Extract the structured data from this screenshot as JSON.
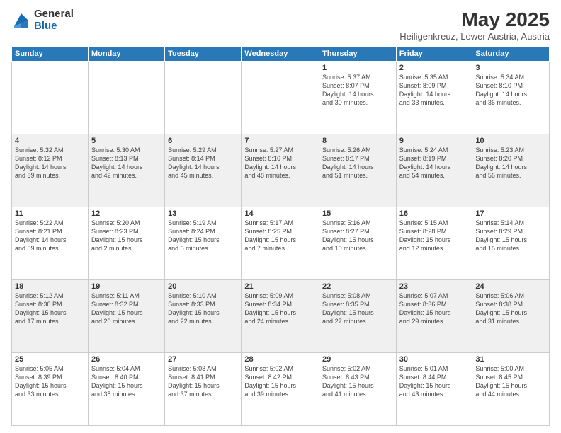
{
  "logo": {
    "general": "General",
    "blue": "Blue"
  },
  "title": {
    "month_year": "May 2025",
    "location": "Heiligenkreuz, Lower Austria, Austria"
  },
  "days_of_week": [
    "Sunday",
    "Monday",
    "Tuesday",
    "Wednesday",
    "Thursday",
    "Friday",
    "Saturday"
  ],
  "weeks": [
    [
      {
        "num": "",
        "info": ""
      },
      {
        "num": "",
        "info": ""
      },
      {
        "num": "",
        "info": ""
      },
      {
        "num": "",
        "info": ""
      },
      {
        "num": "1",
        "info": "Sunrise: 5:37 AM\nSunset: 8:07 PM\nDaylight: 14 hours\nand 30 minutes."
      },
      {
        "num": "2",
        "info": "Sunrise: 5:35 AM\nSunset: 8:09 PM\nDaylight: 14 hours\nand 33 minutes."
      },
      {
        "num": "3",
        "info": "Sunrise: 5:34 AM\nSunset: 8:10 PM\nDaylight: 14 hours\nand 36 minutes."
      }
    ],
    [
      {
        "num": "4",
        "info": "Sunrise: 5:32 AM\nSunset: 8:12 PM\nDaylight: 14 hours\nand 39 minutes."
      },
      {
        "num": "5",
        "info": "Sunrise: 5:30 AM\nSunset: 8:13 PM\nDaylight: 14 hours\nand 42 minutes."
      },
      {
        "num": "6",
        "info": "Sunrise: 5:29 AM\nSunset: 8:14 PM\nDaylight: 14 hours\nand 45 minutes."
      },
      {
        "num": "7",
        "info": "Sunrise: 5:27 AM\nSunset: 8:16 PM\nDaylight: 14 hours\nand 48 minutes."
      },
      {
        "num": "8",
        "info": "Sunrise: 5:26 AM\nSunset: 8:17 PM\nDaylight: 14 hours\nand 51 minutes."
      },
      {
        "num": "9",
        "info": "Sunrise: 5:24 AM\nSunset: 8:19 PM\nDaylight: 14 hours\nand 54 minutes."
      },
      {
        "num": "10",
        "info": "Sunrise: 5:23 AM\nSunset: 8:20 PM\nDaylight: 14 hours\nand 56 minutes."
      }
    ],
    [
      {
        "num": "11",
        "info": "Sunrise: 5:22 AM\nSunset: 8:21 PM\nDaylight: 14 hours\nand 59 minutes."
      },
      {
        "num": "12",
        "info": "Sunrise: 5:20 AM\nSunset: 8:23 PM\nDaylight: 15 hours\nand 2 minutes."
      },
      {
        "num": "13",
        "info": "Sunrise: 5:19 AM\nSunset: 8:24 PM\nDaylight: 15 hours\nand 5 minutes."
      },
      {
        "num": "14",
        "info": "Sunrise: 5:17 AM\nSunset: 8:25 PM\nDaylight: 15 hours\nand 7 minutes."
      },
      {
        "num": "15",
        "info": "Sunrise: 5:16 AM\nSunset: 8:27 PM\nDaylight: 15 hours\nand 10 minutes."
      },
      {
        "num": "16",
        "info": "Sunrise: 5:15 AM\nSunset: 8:28 PM\nDaylight: 15 hours\nand 12 minutes."
      },
      {
        "num": "17",
        "info": "Sunrise: 5:14 AM\nSunset: 8:29 PM\nDaylight: 15 hours\nand 15 minutes."
      }
    ],
    [
      {
        "num": "18",
        "info": "Sunrise: 5:12 AM\nSunset: 8:30 PM\nDaylight: 15 hours\nand 17 minutes."
      },
      {
        "num": "19",
        "info": "Sunrise: 5:11 AM\nSunset: 8:32 PM\nDaylight: 15 hours\nand 20 minutes."
      },
      {
        "num": "20",
        "info": "Sunrise: 5:10 AM\nSunset: 8:33 PM\nDaylight: 15 hours\nand 22 minutes."
      },
      {
        "num": "21",
        "info": "Sunrise: 5:09 AM\nSunset: 8:34 PM\nDaylight: 15 hours\nand 24 minutes."
      },
      {
        "num": "22",
        "info": "Sunrise: 5:08 AM\nSunset: 8:35 PM\nDaylight: 15 hours\nand 27 minutes."
      },
      {
        "num": "23",
        "info": "Sunrise: 5:07 AM\nSunset: 8:36 PM\nDaylight: 15 hours\nand 29 minutes."
      },
      {
        "num": "24",
        "info": "Sunrise: 5:06 AM\nSunset: 8:38 PM\nDaylight: 15 hours\nand 31 minutes."
      }
    ],
    [
      {
        "num": "25",
        "info": "Sunrise: 5:05 AM\nSunset: 8:39 PM\nDaylight: 15 hours\nand 33 minutes."
      },
      {
        "num": "26",
        "info": "Sunrise: 5:04 AM\nSunset: 8:40 PM\nDaylight: 15 hours\nand 35 minutes."
      },
      {
        "num": "27",
        "info": "Sunrise: 5:03 AM\nSunset: 8:41 PM\nDaylight: 15 hours\nand 37 minutes."
      },
      {
        "num": "28",
        "info": "Sunrise: 5:02 AM\nSunset: 8:42 PM\nDaylight: 15 hours\nand 39 minutes."
      },
      {
        "num": "29",
        "info": "Sunrise: 5:02 AM\nSunset: 8:43 PM\nDaylight: 15 hours\nand 41 minutes."
      },
      {
        "num": "30",
        "info": "Sunrise: 5:01 AM\nSunset: 8:44 PM\nDaylight: 15 hours\nand 43 minutes."
      },
      {
        "num": "31",
        "info": "Sunrise: 5:00 AM\nSunset: 8:45 PM\nDaylight: 15 hours\nand 44 minutes."
      }
    ]
  ]
}
